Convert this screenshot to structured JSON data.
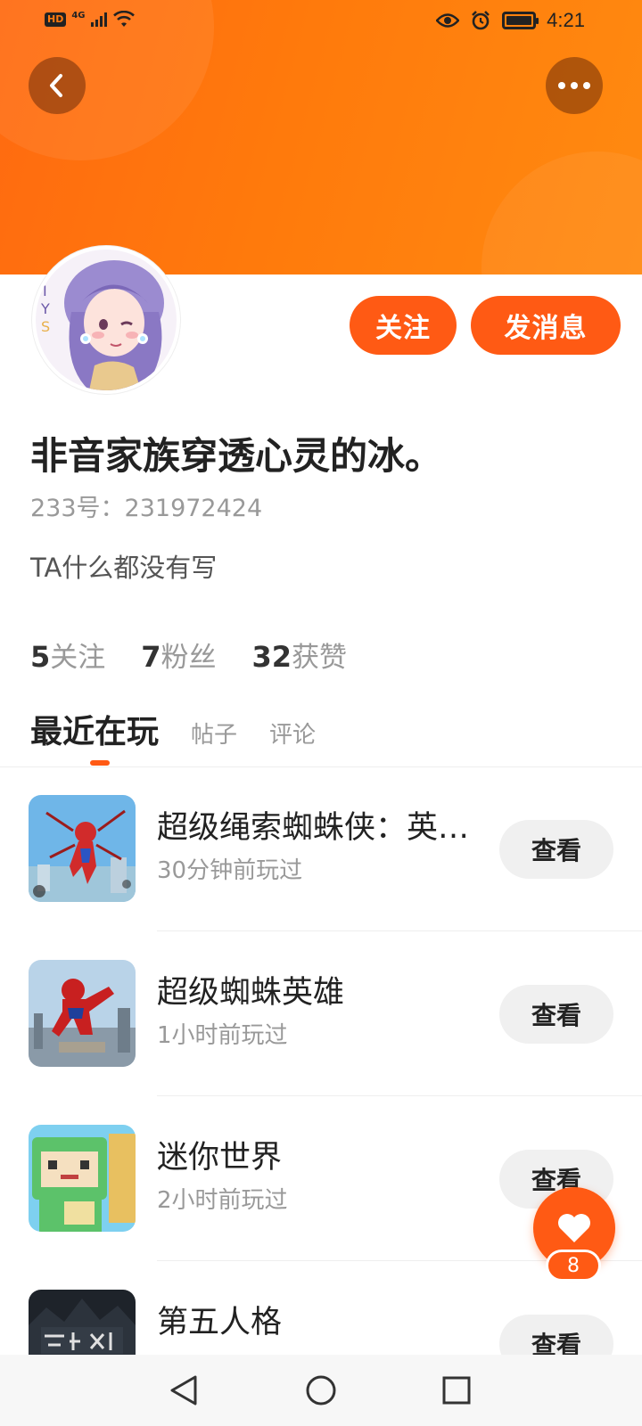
{
  "status_bar": {
    "hd": "HD",
    "network": "4G",
    "time": "4:21"
  },
  "header": {
    "back_icon": "chevron-left-icon",
    "more_icon": "more-dots-icon"
  },
  "profile": {
    "username": "非音家族穿透心灵的冰。",
    "user_id": "233号：231972424",
    "bio": "TA什么都没有写",
    "follow_label": "关注",
    "message_label": "发消息",
    "stats": [
      {
        "value": "5",
        "label": "关注"
      },
      {
        "value": "7",
        "label": "粉丝"
      },
      {
        "value": "32",
        "label": "获赞"
      }
    ]
  },
  "tabs": [
    {
      "label": "最近在玩",
      "active": true
    },
    {
      "label": "帖子",
      "active": false
    },
    {
      "label": "评论",
      "active": false
    }
  ],
  "games": [
    {
      "title": "超级绳索蜘蛛侠：英…",
      "played": "30分钟前玩过",
      "action": "查看"
    },
    {
      "title": "超级蜘蛛英雄",
      "played": "1小时前玩过",
      "action": "查看"
    },
    {
      "title": "迷你世界",
      "played": "2小时前玩过",
      "action": "查看"
    },
    {
      "title": "第五人格",
      "played": "",
      "action": "查看"
    }
  ],
  "like_fab": {
    "count": "8",
    "icon": "heart-icon"
  },
  "colors": {
    "brand": "#ff5a14",
    "banner": "#ff7a0c"
  }
}
